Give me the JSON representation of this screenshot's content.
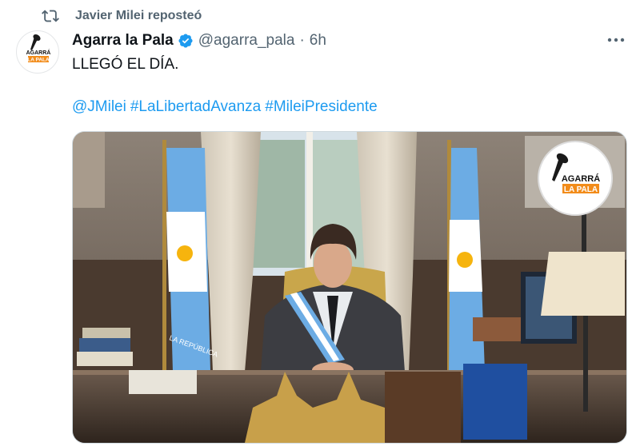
{
  "repost": {
    "icon": "repost-icon",
    "text": "Javier Milei reposteó"
  },
  "author": {
    "name": "Agarra la Pala",
    "handle": "@agarra_pala",
    "separator": "·",
    "time": "6h",
    "verified_icon": "verified-badge-icon",
    "avatar_text_top": "AGARRÁ",
    "avatar_text_bottom": "LA PALA"
  },
  "tweet": {
    "text": "LLEGÓ EL DÍA.",
    "hashtags": [
      "@JMilei",
      "#LaLibertadAvanza",
      "#MileiPresidente"
    ]
  },
  "media": {
    "logo_text_top": "AGARRÁ",
    "logo_text_bottom": "LA PALA",
    "flag_text": "LA REPÚBLICA"
  },
  "colors": {
    "link": "#1d9bf0",
    "secondary_text": "#536471",
    "accent_orange": "#f28c1a",
    "flag_blue": "#6cace4"
  },
  "icons": {
    "more": "more-options-icon"
  }
}
